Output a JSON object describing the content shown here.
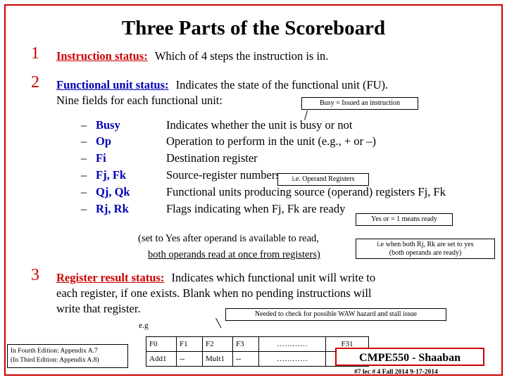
{
  "slide": {
    "title": "Three Parts of the Scoreboard",
    "items": [
      {
        "number": "1",
        "heading": "Instruction status:",
        "body": "Which of 4 steps the instruction is in."
      },
      {
        "number": "2",
        "heading": "Functional unit status:",
        "body": "Indicates the state of the functional unit (FU).",
        "subline": "Nine fields for each functional unit:"
      },
      {
        "number": "3",
        "heading": "Register result status:",
        "body": "Indicates which functional unit will write to",
        "line2": "each register, if one exists.  Blank when no pending instructions will",
        "line3": "write that register."
      }
    ],
    "fields": [
      {
        "dash": "–",
        "term": "Busy",
        "desc": "Indicates whether the unit is busy or not"
      },
      {
        "dash": "–",
        "term": "Op",
        "desc": "Operation to perform in the unit (e.g., + or –)"
      },
      {
        "dash": "–",
        "term": "Fi",
        "desc": "Destination register"
      },
      {
        "dash": "–",
        "term": "Fj, Fk",
        "desc": "Source-register numbers"
      },
      {
        "dash": "–",
        "term": "Qj, Qk",
        "desc": "Functional units producing source (operand) registers Fj, Fk"
      },
      {
        "dash": "–",
        "term": "Rj, Rk",
        "desc": "Flags indicating when Fj, Fk are ready"
      }
    ],
    "paren_lines": {
      "line1_prefix": "(set to Yes after operand is available to read,",
      "line2": "both operands read at once from registers)"
    },
    "callouts": {
      "busy_issued": "Busy = Issued an instruction",
      "operand_registers": "i.e. Operand Registers",
      "yes_or_1": "Yes or = 1 means ready",
      "both_ready_line1": "i.e when both Rj, Rk are set to yes",
      "both_ready_line2": "(both operands are ready)",
      "waw_hazard": "Needed to check for possible WAW hazard and stall issue"
    },
    "eg_label": "e.g",
    "reg_table": {
      "header_row": [
        "F0",
        "F1",
        "F2",
        "F3",
        "…………",
        "F31"
      ],
      "value_row": [
        "Add1",
        "--",
        "Mult1",
        "--",
        "…………",
        "--"
      ]
    },
    "edition_note": {
      "line1": "In Fourth Edition: Appendix A.7",
      "line2": "(In Third Edition: Appendix A.8)"
    },
    "footer": {
      "course": "CMPE550 - Shaaban",
      "meta": "#7  lec # 4  Fall 2014   9-17-2014"
    },
    "colors": {
      "border": "#cc0000",
      "heading_red": "#cc0000",
      "heading_blue": "#0000bb",
      "text": "#000000"
    }
  }
}
